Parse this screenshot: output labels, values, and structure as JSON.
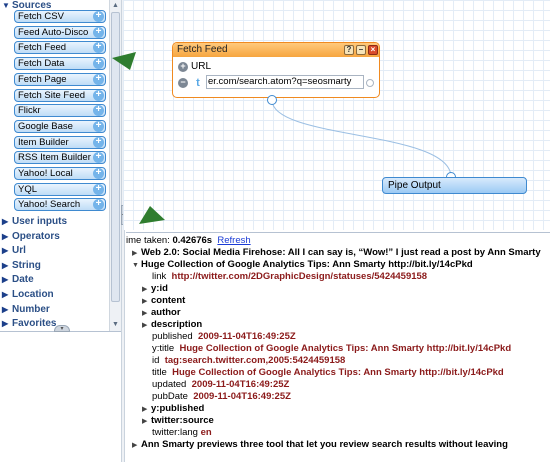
{
  "sidebar": {
    "sources_header": "Sources",
    "modules": [
      "Fetch CSV",
      "Feed Auto-Disco",
      "Fetch Feed",
      "Fetch Data",
      "Fetch Page",
      "Fetch Site Feed",
      "Flickr",
      "Google Base",
      "Item Builder",
      "RSS Item Builder",
      "Yahoo! Local",
      "YQL",
      "Yahoo! Search"
    ],
    "categories": [
      "User inputs",
      "Operators",
      "Url",
      "String",
      "Date",
      "Location",
      "Number",
      "Favorites"
    ]
  },
  "canvas": {
    "fetch_feed": {
      "title": "Fetch Feed",
      "url_label": "URL",
      "url_value": "er.com/search.atom?q=seosmarty"
    },
    "pipe_output": {
      "title": "Pipe Output"
    }
  },
  "debugger": {
    "time_label": "ime taken:",
    "time_value": "0.42676s",
    "refresh": "Refresh",
    "item1": "Web 2.0: Social Media Firehose: All I can say is, “Wow!” I just read a post by Ann Smarty",
    "item2": "Huge Collection of Google Analytics Tips: Ann Smarty http://bit.ly/14cPkd",
    "link_key": "link",
    "link_val": "http://twitter.com/2DGraphicDesign/statuses/5424459158",
    "yid": "y:id",
    "content": "content",
    "author": "author",
    "description": "description",
    "published_key": "published",
    "published_val": "2009-11-04T16:49:25Z",
    "ytitle_key": "y:title",
    "ytitle_val": "Huge Collection of Google Analytics Tips: Ann Smarty http://bit.ly/14cPkd",
    "id_key": "id",
    "id_val": "tag:search.twitter.com,2005:5424459158",
    "title_key": "title",
    "title_val": "Huge Collection of Google Analytics Tips: Ann Smarty http://bit.ly/14cPkd",
    "updated_key": "updated",
    "updated_val": "2009-11-04T16:49:25Z",
    "pubdate_key": "pubDate",
    "pubdate_val": "2009-11-04T16:49:25Z",
    "ypublished": "y:published",
    "twsource": "twitter:source",
    "twlang_key": "twitter:lang",
    "twlang_val": "en",
    "item3": "Ann Smarty previews three tool that let you review search results without leaving"
  },
  "colors": {
    "accent_orange": "#f08a20",
    "accent_blue": "#3f8ad0",
    "value_red": "#8b1a1a",
    "arrow_green": "#2f7d2f"
  }
}
